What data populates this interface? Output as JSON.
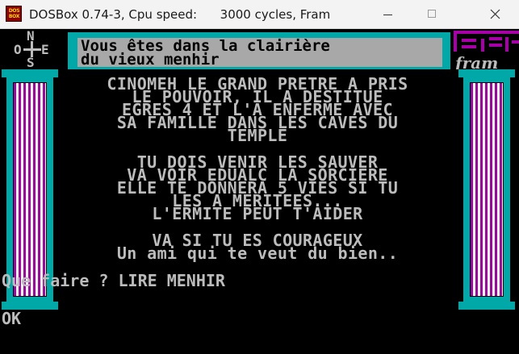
{
  "window": {
    "icon_label_top": "DOS",
    "icon_label_bottom": "BOX",
    "title": "DOSBox 0.74-3, Cpu speed:      3000 cycles, Fram",
    "minimize_label": "",
    "maximize_label": "",
    "close_label": ""
  },
  "compass": {
    "north": "N",
    "west": "O",
    "east": "E",
    "south": "S"
  },
  "location": {
    "line1": "Vous êtes dans la clairière",
    "line2": "du vieux menhir"
  },
  "logo": {
    "text": "fram"
  },
  "message": [
    "CINOMEH LE GRAND PRETRE A PRIS",
    "LE POUVOIR, IL A DESTITUE",
    "EGRES 4 ET L'A ENFERME AVEC",
    "SA FAMILLE DANS LES CAVES DU",
    "TEMPLE",
    "",
    "TU DOIS VENIR LES SAUVER",
    "VA VOIR EDUALC LA SORCIERE",
    "ELLE TE DONNERA 5 VIES SI TU",
    "LES A MERITEES...",
    "L'ERMITE PEUT T'AIDER",
    "",
    "VA SI TU ES COURAGEUX",
    "Un ami qui te veut du bien.."
  ],
  "prompt": {
    "question": "Que faire ? LIRE MENHIR",
    "response": "OK"
  },
  "colors": {
    "cyan": "#00a8a8",
    "magenta": "#a800a8",
    "gray": "#a8a8a8",
    "text": "#bcbcbc"
  }
}
